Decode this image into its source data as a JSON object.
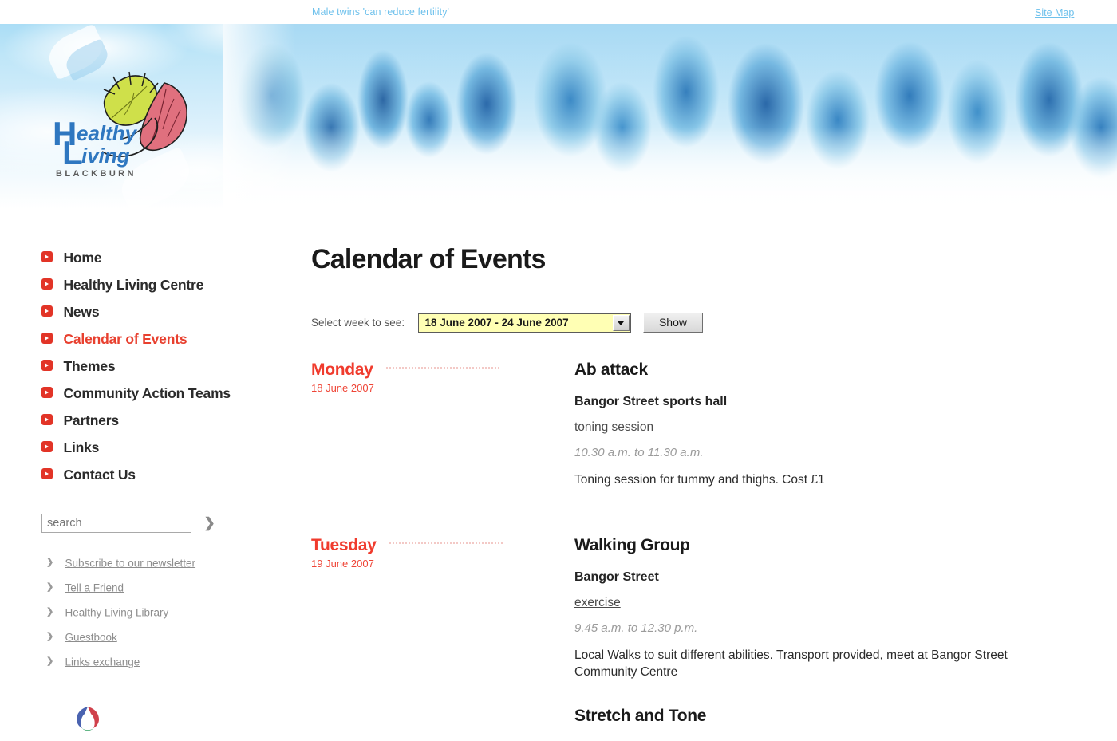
{
  "top": {
    "ticker": "Male twins 'can reduce fertility'",
    "sitemap": "Site Map"
  },
  "logo": {
    "word_top": "ealthy",
    "word_bottom": "iving",
    "big_h": "H",
    "big_l": "L",
    "town": "BLACKBURN"
  },
  "sidebar": {
    "nav": [
      {
        "label": "Home",
        "active": false
      },
      {
        "label": "Healthy Living Centre",
        "active": false
      },
      {
        "label": "News",
        "active": false
      },
      {
        "label": "Calendar of Events",
        "active": true
      },
      {
        "label": "Themes",
        "active": false
      },
      {
        "label": "Community Action Teams",
        "active": false
      },
      {
        "label": "Partners",
        "active": false
      },
      {
        "label": "Links",
        "active": false
      },
      {
        "label": "Contact Us",
        "active": false
      }
    ],
    "search": {
      "placeholder": "search",
      "value": "",
      "go_icon": "arrow-right-icon"
    },
    "sublinks": [
      {
        "label": "Subscribe to our newsletter"
      },
      {
        "label": "Tell a Friend"
      },
      {
        "label": "Healthy Living Library"
      },
      {
        "label": "Guestbook"
      },
      {
        "label": "Links exchange"
      }
    ]
  },
  "main": {
    "title": "Calendar of Events",
    "selector": {
      "label": "Select week to see:",
      "selected_week": "18 June 2007 - 24 June 2007",
      "show_label": "Show"
    },
    "days": [
      {
        "name": "Monday",
        "date": "18 June 2007",
        "event": {
          "title": "Ab attack",
          "venue": "Bangor Street sports hall",
          "category": "toning session",
          "time": "10.30 a.m. to 11.30 a.m.",
          "description": "Toning session for tummy and thighs. Cost £1"
        }
      },
      {
        "name": "Tuesday",
        "date": "19 June 2007",
        "event": {
          "title": "Walking Group",
          "venue": "Bangor Street",
          "category": "exercise",
          "time": "9.45 a.m. to 12.30 p.m.",
          "description": "Local Walks to suit different abilities. Transport provided, meet at Bangor Street Community Centre"
        }
      },
      {
        "name": "",
        "date": "",
        "event": {
          "title": "Stretch and Tone",
          "venue": "",
          "category": "",
          "time": "",
          "description": ""
        }
      }
    ]
  },
  "colors": {
    "accent_red": "#e8402f",
    "bullet_red": "#e23427",
    "link_blue": "#6ec1ec",
    "select_yellow": "#ffffb4",
    "sky_blue": "#a8dcf5"
  }
}
